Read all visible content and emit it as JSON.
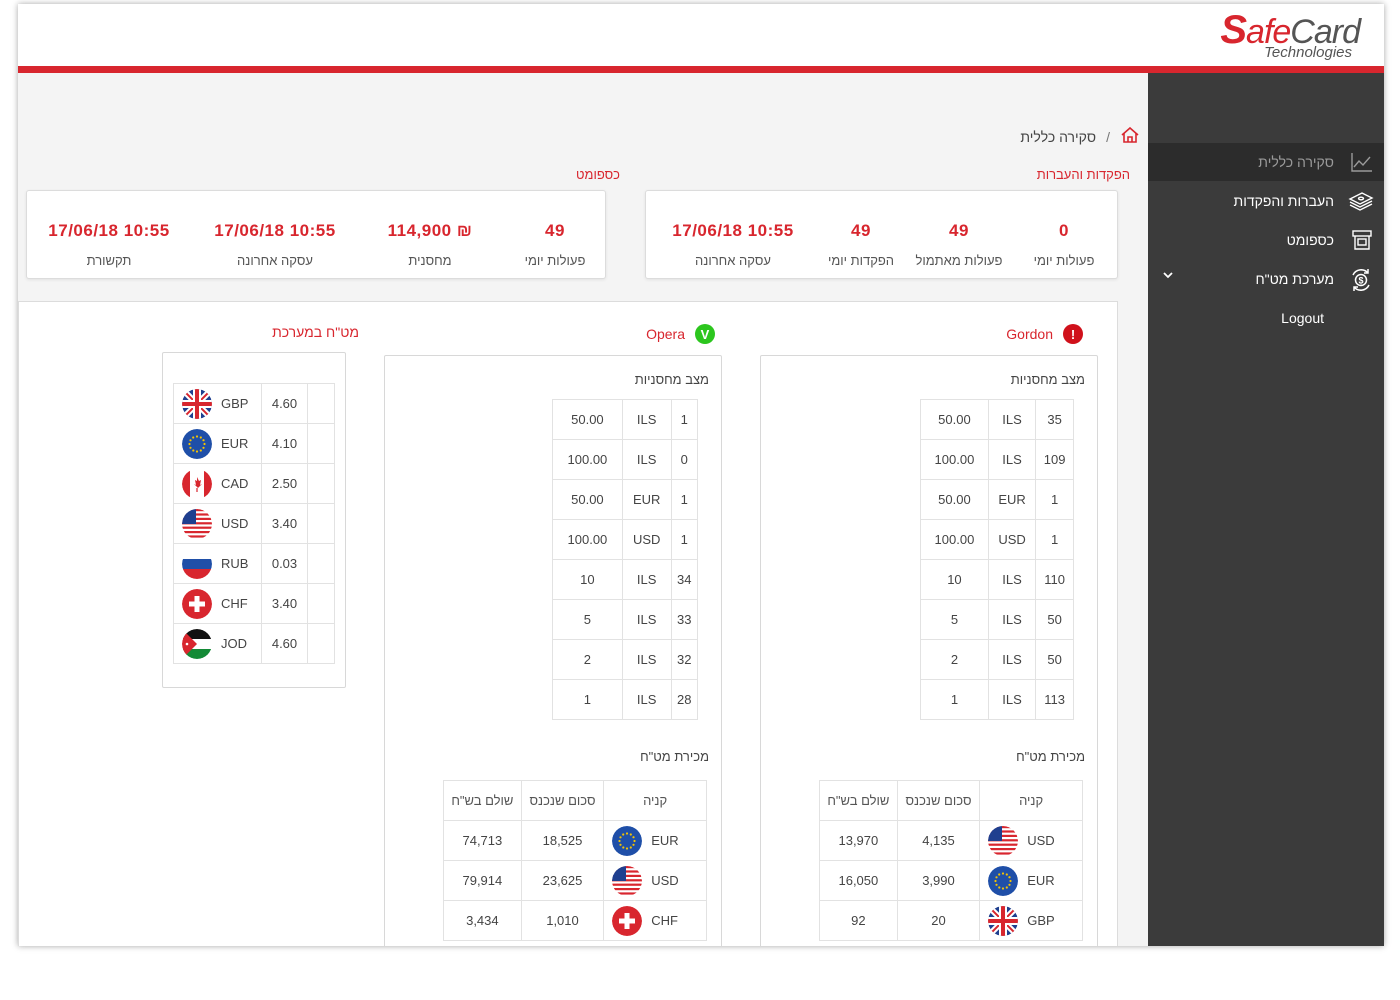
{
  "logo": {
    "brand_s": "S",
    "brand_afe": "afe",
    "brand_card": "Card",
    "sub": "Technologies"
  },
  "sidebar": {
    "items": [
      {
        "label": "סקירה כללית",
        "icon": "chart-icon"
      },
      {
        "label": "העברות והפקדות",
        "icon": "money-stack-icon"
      },
      {
        "label": "כספומט",
        "icon": "atm-icon"
      },
      {
        "label": "מערכת מט\"ח",
        "icon": "currency-exchange-icon"
      },
      {
        "label": "Logout"
      }
    ]
  },
  "breadcrumb": {
    "separator": "/",
    "current": "סקירה כללית"
  },
  "deposits": {
    "title": "הפקדות והעברות",
    "stats": [
      {
        "value": "0",
        "label": "פעולות יומי"
      },
      {
        "value": "49",
        "label": "פעולות מאתמול"
      },
      {
        "value": "49",
        "label": "הפקדות יומי"
      },
      {
        "value": "10:55 17/06/18",
        "label": "עסקה אחרונה"
      }
    ]
  },
  "atm": {
    "title": "כספומט",
    "stats": [
      {
        "value": "49",
        "label": "פעולות יומי"
      },
      {
        "value": "₪ 114,900",
        "label": "מחסנית"
      },
      {
        "value": "10:55 17/06/18",
        "label": "עסקה אחרונה"
      },
      {
        "value": "10:55 17/06/18",
        "label": "תקשורת"
      }
    ]
  },
  "machines": [
    {
      "name": "Gordon",
      "status": "error",
      "status_glyph": "!",
      "inventory_title": "מצב מחסניות",
      "inventory": [
        {
          "count": "35",
          "currency": "ILS",
          "denom": "50.00"
        },
        {
          "count": "109",
          "currency": "ILS",
          "denom": "100.00"
        },
        {
          "count": "1",
          "currency": "EUR",
          "denom": "50.00"
        },
        {
          "count": "1",
          "currency": "USD",
          "denom": "100.00"
        },
        {
          "count": "110",
          "currency": "ILS",
          "denom": "10"
        },
        {
          "count": "50",
          "currency": "ILS",
          "denom": "5"
        },
        {
          "count": "50",
          "currency": "ILS",
          "denom": "2"
        },
        {
          "count": "113",
          "currency": "ILS",
          "denom": "1"
        }
      ],
      "sales_title": "מכירת מט\"ח",
      "sales_headers": [
        "קניה",
        "סכום שנכנס",
        "שולם בש\"ח"
      ],
      "sales": [
        {
          "currency": "USD",
          "flag": "us",
          "amount_in": "4,135",
          "paid_ils": "13,970"
        },
        {
          "currency": "EUR",
          "flag": "eu",
          "amount_in": "3,990",
          "paid_ils": "16,050"
        },
        {
          "currency": "GBP",
          "flag": "gb",
          "amount_in": "20",
          "paid_ils": "92"
        }
      ]
    },
    {
      "name": "Opera",
      "status": "ok",
      "status_glyph": "V",
      "inventory_title": "מצב מחסניות",
      "inventory": [
        {
          "count": "1",
          "currency": "ILS",
          "denom": "50.00"
        },
        {
          "count": "0",
          "currency": "ILS",
          "denom": "100.00"
        },
        {
          "count": "1",
          "currency": "EUR",
          "denom": "50.00"
        },
        {
          "count": "1",
          "currency": "USD",
          "denom": "100.00"
        },
        {
          "count": "34",
          "currency": "ILS",
          "denom": "10"
        },
        {
          "count": "33",
          "currency": "ILS",
          "denom": "5"
        },
        {
          "count": "32",
          "currency": "ILS",
          "denom": "2"
        },
        {
          "count": "28",
          "currency": "ILS",
          "denom": "1"
        }
      ],
      "sales_title": "מכירת מט\"ח",
      "sales_headers": [
        "קניה",
        "סכום שנכנס",
        "שולם בש\"ח"
      ],
      "sales": [
        {
          "currency": "EUR",
          "flag": "eu",
          "amount_in": "18,525",
          "paid_ils": "74,713"
        },
        {
          "currency": "USD",
          "flag": "us",
          "amount_in": "23,625",
          "paid_ils": "79,914"
        },
        {
          "currency": "CHF",
          "flag": "ch",
          "amount_in": "1,010",
          "paid_ils": "3,434"
        }
      ]
    }
  ],
  "rates": {
    "title": "מט\"ח במערכת",
    "items": [
      {
        "currency": "GBP",
        "flag": "gb",
        "rate": "4.60"
      },
      {
        "currency": "EUR",
        "flag": "eu",
        "rate": "4.10"
      },
      {
        "currency": "CAD",
        "flag": "ca",
        "rate": "2.50"
      },
      {
        "currency": "USD",
        "flag": "us",
        "rate": "3.40"
      },
      {
        "currency": "RUB",
        "flag": "ru",
        "rate": "0.03"
      },
      {
        "currency": "CHF",
        "flag": "ch",
        "rate": "3.40"
      },
      {
        "currency": "JOD",
        "flag": "jo",
        "rate": "4.60"
      }
    ]
  },
  "colors": {
    "accent": "#d8262e",
    "sidebar": "#3b3b3b",
    "error": "#d0111b",
    "ok": "#2cc61e"
  }
}
